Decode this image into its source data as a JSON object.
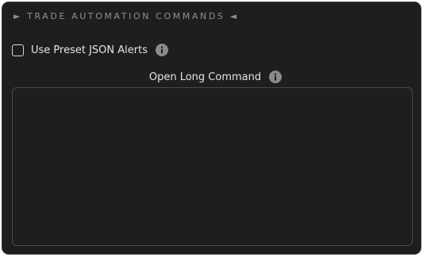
{
  "section": {
    "title": "► TRADE AUTOMATION COMMANDS ◄"
  },
  "preset": {
    "label": "Use Preset JSON Alerts",
    "checked": false,
    "info_icon": "info-icon"
  },
  "open_long": {
    "label": "Open Long Command",
    "value": "",
    "info_icon": "info-icon"
  },
  "colors": {
    "panel_background": "#1e1e1e",
    "panel_border": "#3a3a3a",
    "text": "#e4e4e4",
    "muted_text": "#8f8f8f",
    "info_icon": "#8a8a8a"
  }
}
